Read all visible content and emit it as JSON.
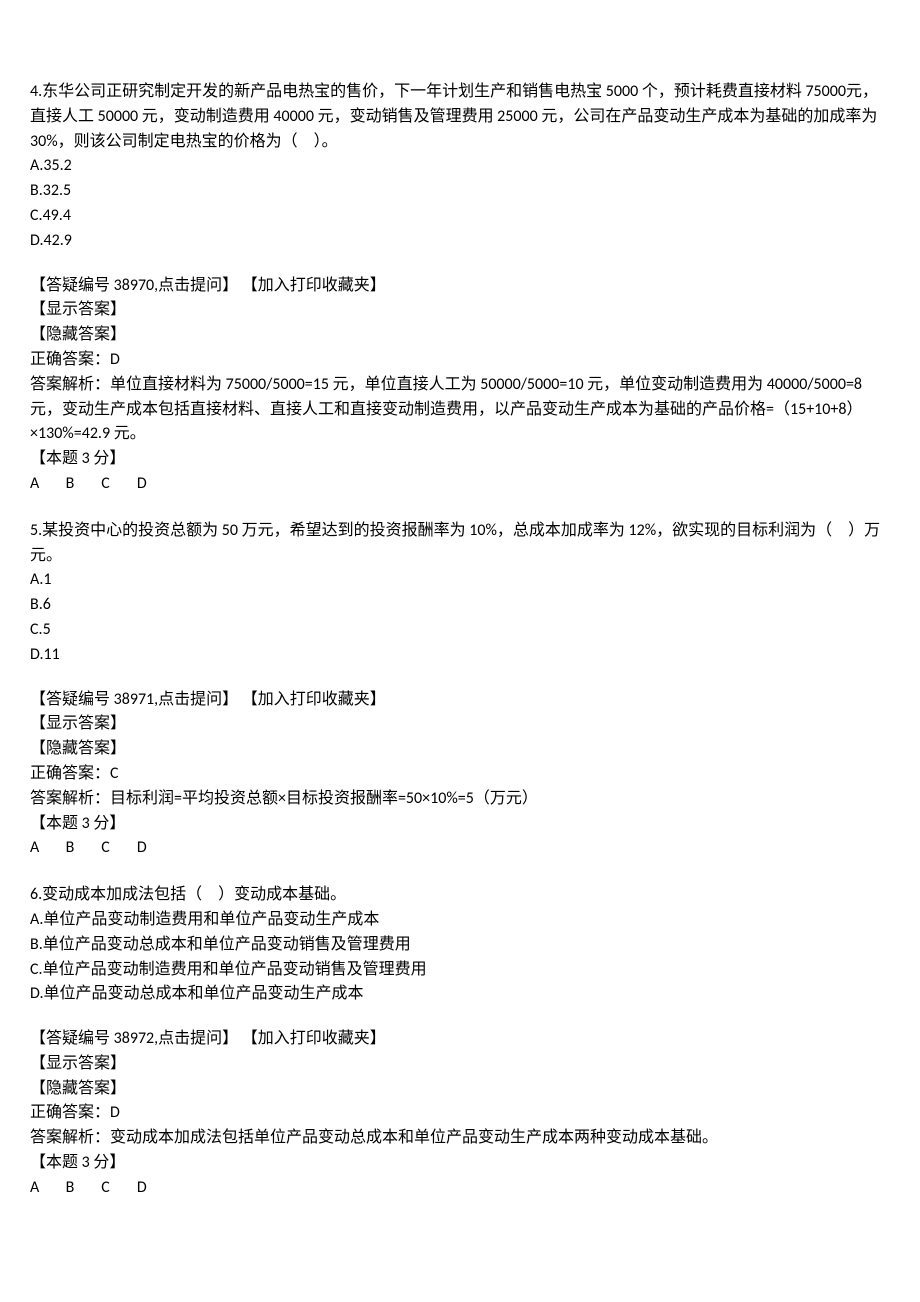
{
  "q4": {
    "stem": "4.东华公司正研究制定开发的新产品电热宝的售价，下一年计划生产和销售电热宝 5000 个，预计耗费直接材料 75000元，直接人工 50000 元，变动制造费用 40000 元，变动销售及管理费用 25000 元，公司在产品变动生产成本为基础的加成率为 30%，则该公司制定电热宝的价格为（　）。",
    "optA": "A.35.2",
    "optB": "B.32.5",
    "optC": "C.49.4",
    "optD": "D.42.9",
    "askline": "【答疑编号 38970,点击提问】 【加入打印收藏夹】",
    "show": "【显示答案】",
    "hide": "【隐藏答案】",
    "correct": "正确答案：D",
    "explain": "答案解析：单位直接材料为 75000/5000=15 元，单位直接人工为 50000/5000=10 元，单位变动制造费用为 40000/5000=8元，变动生产成本包括直接材料、直接人工和直接变动制造费用，以产品变动生产成本为基础的产品价格=（15+10+8）×130%=42.9 元。",
    "score": "【本题 3 分】",
    "choices": {
      "a": "A",
      "b": "B",
      "c": "C",
      "d": "D"
    }
  },
  "q5": {
    "stem": "5.某投资中心的投资总额为 50 万元，希望达到的投资报酬率为 10%，总成本加成率为 12%，欲实现的目标利润为（　）万元。",
    "optA": "A.1",
    "optB": "B.6",
    "optC": "C.5",
    "optD": "D.11",
    "askline": "【答疑编号 38971,点击提问】 【加入打印收藏夹】",
    "show": "【显示答案】",
    "hide": "【隐藏答案】",
    "correct": "正确答案：C",
    "explain": "答案解析：目标利润=平均投资总额×目标投资报酬率=50×10%=5（万元）",
    "score": "【本题 3 分】",
    "choices": {
      "a": "A",
      "b": "B",
      "c": "C",
      "d": "D"
    }
  },
  "q6": {
    "stem": "6.变动成本加成法包括（　）变动成本基础。",
    "optA": "A.单位产品变动制造费用和单位产品变动生产成本",
    "optB": "B.单位产品变动总成本和单位产品变动销售及管理费用",
    "optC": "C.单位产品变动制造费用和单位产品变动销售及管理费用",
    "optD": "D.单位产品变动总成本和单位产品变动生产成本",
    "askline": "【答疑编号 38972,点击提问】 【加入打印收藏夹】",
    "show": "【显示答案】",
    "hide": "【隐藏答案】",
    "correct": "正确答案：D",
    "explain": "答案解析：变动成本加成法包括单位产品变动总成本和单位产品变动生产成本两种变动成本基础。",
    "score": "【本题 3 分】",
    "choices": {
      "a": "A",
      "b": "B",
      "c": "C",
      "d": "D"
    }
  }
}
